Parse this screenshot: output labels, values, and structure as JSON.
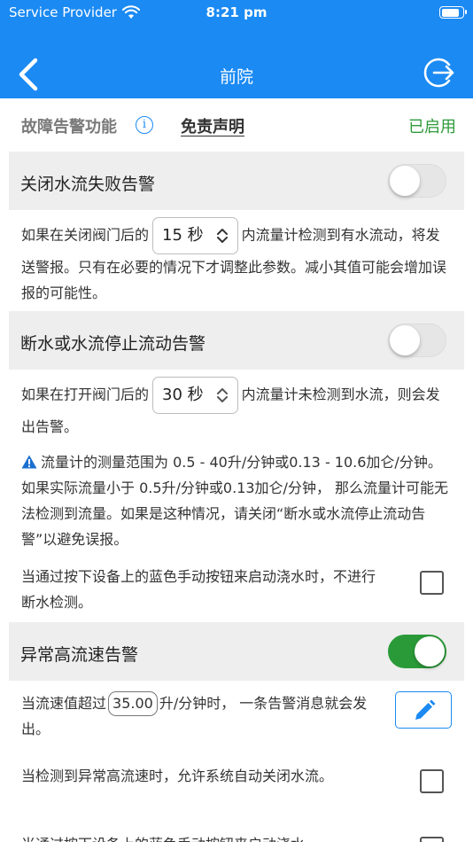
{
  "status_bar": {
    "carrier": "Service Provider",
    "time": "8:21 pm",
    "battery_level": 0.9
  },
  "nav": {
    "title": "前院"
  },
  "top_row": {
    "feature_label": "故障告警功能",
    "info_icon": "i",
    "disclaimer": "免责声明",
    "status": "已启用"
  },
  "close_fail": {
    "title": "关闭水流失败告警",
    "enabled": false,
    "text_before": "如果在关闭阀门后的",
    "select_value": "15 秒",
    "text_after": "内流量计检测到有水流动，将发送警报。只有在必要的情况下才调整此参数。减小其值可能会增加误报的可能性。"
  },
  "stop_flow": {
    "title": "断水或水流停止流动告警",
    "enabled": false,
    "text_before": "如果在打开阀门后的",
    "select_value": "30 秒",
    "text_after": "内流量计未检测到水流，则会发出告警。",
    "warning": "流量计的测量范围为 0.5 - 40升/分钟或0.13 - 10.6加仑/分钟。 如果实际流量小于 0.5升/分钟或0.13加仑/分钟， 那么流量计可能无法检测到流量。如果是这种情况，请关闭“断水或水流停止流动告警”以避免误报。",
    "manual_text": "当通过按下设备上的蓝色手动按钮来启动浇水时，不进行断水检测。",
    "manual_checked": false
  },
  "high_flow": {
    "title": "异常高流速告警",
    "enabled": true,
    "text_before": "当流速值超过",
    "value": "35.00",
    "text_after": "升/分钟时， 一条告警消息就会发出。",
    "auto_close_text": "当检测到异常高流速时，允许系统自动关闭水流。",
    "auto_close_checked": false,
    "manual_text_partial": "当通过按下设备上的蓝色手动按钮来启动浇水"
  },
  "colors": {
    "header": "#1b8af3",
    "enabled": "#2e9a3a",
    "toggle_on": "#2a9a38",
    "section_bg": "#eeeeee"
  }
}
